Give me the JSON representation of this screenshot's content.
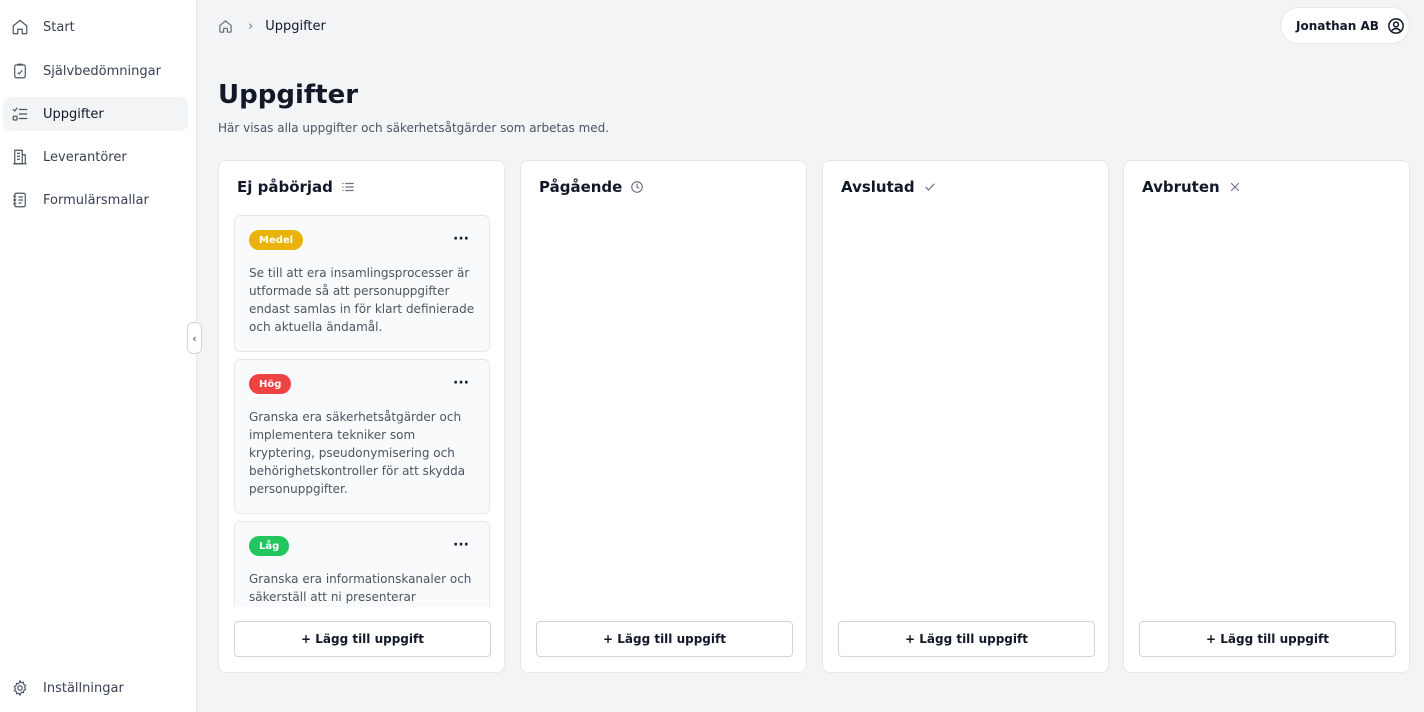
{
  "sidebar": {
    "items": [
      {
        "label": "Start",
        "icon": "home-icon"
      },
      {
        "label": "Självbedömningar",
        "icon": "clipboard-icon"
      },
      {
        "label": "Uppgifter",
        "icon": "task-list-icon"
      },
      {
        "label": "Leverantörer",
        "icon": "building-icon"
      },
      {
        "label": "Formulärsmallar",
        "icon": "notebook-icon"
      }
    ],
    "settings": {
      "label": "Inställningar",
      "icon": "gear-icon"
    },
    "collapse_glyph": "‹"
  },
  "breadcrumb": {
    "separator": "›",
    "current": "Uppgifter"
  },
  "account": {
    "name": "Jonathan AB"
  },
  "page": {
    "title": "Uppgifter",
    "subtitle": "Här visas alla uppgifter och säkerhetsåtgärder som arbetas med."
  },
  "columns": [
    {
      "title": "Ej påbörjad",
      "icon": "list-icon",
      "add_label": "+ Lägg till uppgift"
    },
    {
      "title": "Pågående",
      "icon": "clock-icon",
      "add_label": "+ Lägg till uppgift"
    },
    {
      "title": "Avslutad",
      "icon": "check-icon",
      "add_label": "+ Lägg till uppgift"
    },
    {
      "title": "Avbruten",
      "icon": "x-icon",
      "add_label": "+ Lägg till uppgift"
    }
  ],
  "cards": [
    {
      "priority": "Medel",
      "color": "#eab308",
      "more": "···",
      "text": "Se till att era insamlingsprocesser är utformade så att personuppgifter endast samlas in för klart definierade och aktuella ändamål."
    },
    {
      "priority": "Hög",
      "color": "#ef4444",
      "more": "···",
      "text": "Granska era säkerhetsåtgärder och implementera tekniker som kryptering, pseudonymisering och behörighetskontroller för att skydda personuppgifter."
    },
    {
      "priority": "Låg",
      "color": "#22c55e",
      "more": "···",
      "text": "Granska era informationskanaler och säkerställ att ni presenterar"
    }
  ]
}
